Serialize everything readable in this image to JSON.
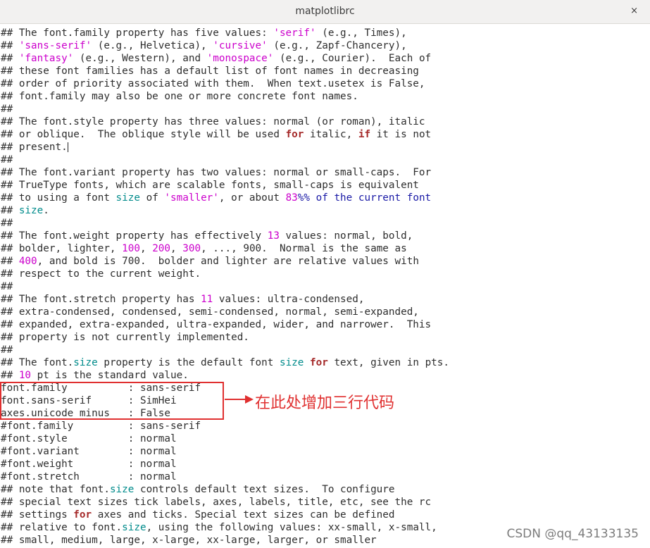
{
  "window": {
    "title": "matplotlibrc",
    "close_glyph": "×"
  },
  "annotation": {
    "text": "在此处增加三行代码",
    "color": "#e03030"
  },
  "watermark": "CSDN @qq_43133135",
  "lines": [
    [
      [
        "## The font.family property has five values: ",
        ""
      ],
      [
        "'serif'",
        "str"
      ],
      [
        " (e.g., Times),",
        ""
      ]
    ],
    [
      [
        "## ",
        ""
      ],
      [
        "'sans-serif'",
        "str"
      ],
      [
        " (e.g., Helvetica), ",
        ""
      ],
      [
        "'cursive'",
        "str"
      ],
      [
        " (e.g., Zapf-Chancery),",
        ""
      ]
    ],
    [
      [
        "## ",
        ""
      ],
      [
        "'fantasy'",
        "str"
      ],
      [
        " (e.g., Western), and ",
        ""
      ],
      [
        "'monospace'",
        "str"
      ],
      [
        " (e.g., Courier).  Each of",
        ""
      ]
    ],
    [
      [
        "## these font families has a default list of font names in decreasing",
        ""
      ]
    ],
    [
      [
        "## order of priority associated with them.  When text.usetex is False,",
        ""
      ]
    ],
    [
      [
        "## font.family may also be one or more concrete font names.",
        ""
      ]
    ],
    [
      [
        "##",
        ""
      ]
    ],
    [
      [
        "## The font.style property has three values: normal (or roman), italic",
        ""
      ]
    ],
    [
      [
        "## or oblique.  The oblique style will be used ",
        ""
      ],
      [
        "for",
        "kw"
      ],
      [
        " italic, ",
        ""
      ],
      [
        "if",
        "kw"
      ],
      [
        " it is not",
        ""
      ]
    ],
    [
      [
        "## present.",
        ""
      ],
      [
        "",
        "cursor"
      ]
    ],
    [
      [
        "##",
        ""
      ]
    ],
    [
      [
        "## The font.variant property has two values: normal or small-caps.  For",
        ""
      ]
    ],
    [
      [
        "## TrueType fonts, which are scalable fonts, small-caps is equivalent",
        ""
      ]
    ],
    [
      [
        "## to using a font ",
        ""
      ],
      [
        "size",
        "teal"
      ],
      [
        " of ",
        ""
      ],
      [
        "'smaller'",
        "str"
      ],
      [
        ", or about ",
        ""
      ],
      [
        "83",
        "num"
      ],
      [
        "%% of the current font",
        "blu"
      ]
    ],
    [
      [
        "## ",
        ""
      ],
      [
        "size",
        "teal"
      ],
      [
        ".",
        ""
      ]
    ],
    [
      [
        "##",
        ""
      ]
    ],
    [
      [
        "## The font.weight property has effectively ",
        ""
      ],
      [
        "13",
        "num"
      ],
      [
        " values: normal, bold,",
        ""
      ]
    ],
    [
      [
        "## bolder, lighter, ",
        ""
      ],
      [
        "100",
        "num"
      ],
      [
        ", ",
        ""
      ],
      [
        "200",
        "num"
      ],
      [
        ", ",
        ""
      ],
      [
        "300",
        "num"
      ],
      [
        ", ..., 900.  Normal is the same as",
        ""
      ]
    ],
    [
      [
        "## ",
        ""
      ],
      [
        "400",
        "num"
      ],
      [
        ", and bold is 700.  bolder and lighter are relative values with",
        ""
      ]
    ],
    [
      [
        "## respect to the current weight.",
        ""
      ]
    ],
    [
      [
        "##",
        ""
      ]
    ],
    [
      [
        "## The font.stretch property has ",
        ""
      ],
      [
        "11",
        "num"
      ],
      [
        " values: ultra-condensed,",
        ""
      ]
    ],
    [
      [
        "## extra-condensed, condensed, semi-condensed, normal, semi-expanded,",
        ""
      ]
    ],
    [
      [
        "## expanded, extra-expanded, ultra-expanded, wider, and narrower.  This",
        ""
      ]
    ],
    [
      [
        "## property is not currently implemented.",
        ""
      ]
    ],
    [
      [
        "##",
        ""
      ]
    ],
    [
      [
        "## The font.",
        ""
      ],
      [
        "size",
        "teal"
      ],
      [
        " property is the default font ",
        ""
      ],
      [
        "size",
        "teal"
      ],
      [
        " ",
        ""
      ],
      [
        "for",
        "kw"
      ],
      [
        " text, given in pts.",
        ""
      ]
    ],
    [
      [
        "## ",
        ""
      ],
      [
        "10",
        "num"
      ],
      [
        " pt is the standard value.",
        ""
      ]
    ],
    [
      [
        "font.family          : sans-serif",
        ""
      ]
    ],
    [
      [
        "font.sans-serif      : SimHei",
        ""
      ]
    ],
    [
      [
        "axes.unicode_minus   : False",
        ""
      ]
    ],
    [
      [
        "#font.family         : sans-serif",
        ""
      ]
    ],
    [
      [
        "#font.style          : normal",
        ""
      ]
    ],
    [
      [
        "#font.variant        : normal",
        ""
      ]
    ],
    [
      [
        "#font.weight         : normal",
        ""
      ]
    ],
    [
      [
        "#font.stretch        : normal",
        ""
      ]
    ],
    [
      [
        "## note that font.",
        ""
      ],
      [
        "size",
        "teal"
      ],
      [
        " controls default text sizes.  To configure",
        ""
      ]
    ],
    [
      [
        "## special text sizes tick labels, axes, labels, title, etc, see the rc",
        ""
      ]
    ],
    [
      [
        "## settings ",
        ""
      ],
      [
        "for",
        "kw"
      ],
      [
        " axes and ticks. Special text sizes can be defined",
        ""
      ]
    ],
    [
      [
        "## relative to font.",
        ""
      ],
      [
        "size",
        "teal"
      ],
      [
        ", using the following values: xx-small, x-small,",
        ""
      ]
    ],
    [
      [
        "## small, medium, large, x-large, xx-large, larger, or smaller",
        ""
      ]
    ]
  ]
}
